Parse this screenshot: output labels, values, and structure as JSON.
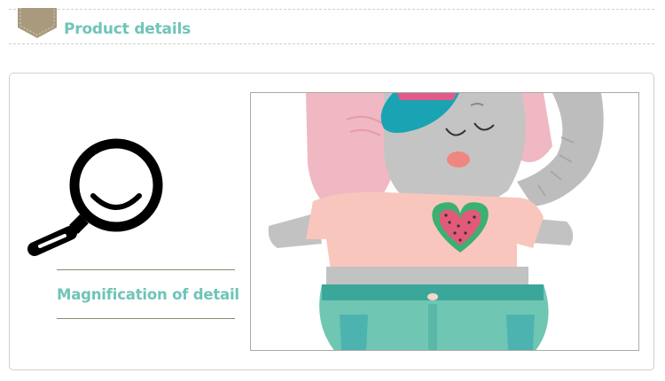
{
  "header": {
    "title": "Product details"
  },
  "detail": {
    "caption": "Magnification of detail"
  },
  "colors": {
    "accent_teal": "#6fc4b8",
    "badge_tan": "#a99a7e",
    "rule_olive": "#8c8a6e",
    "elephant_gray": "#c2c2c2",
    "ear_pink": "#f0b9c3",
    "cap_teal": "#1aa3b3",
    "shirt_pink": "#f8c6bd",
    "pants_teal": "#6fc6b3"
  },
  "icons": {
    "header_badge": "shield-badge-icon",
    "magnifier": "magnifier-icon"
  }
}
